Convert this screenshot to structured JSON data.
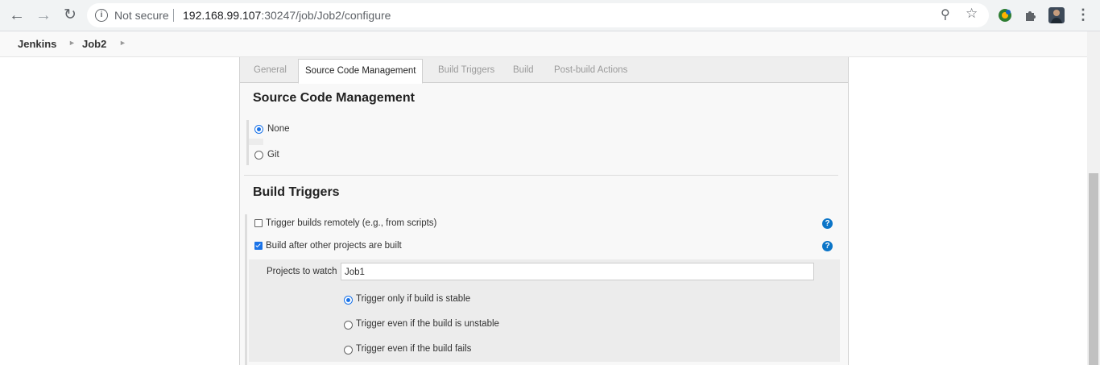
{
  "browser": {
    "not_secure": "Not secure",
    "url_host": "192.168.99.107",
    "url_rest": ":30247/job/Job2/configure",
    "icons": [
      "back-icon",
      "forward-icon",
      "reload-icon",
      "info-icon",
      "zoom-icon",
      "star-icon",
      "extension-icon",
      "puzzle-icon",
      "avatar",
      "menu-icon"
    ]
  },
  "breadcrumb": {
    "items": [
      "Jenkins",
      "Job2"
    ]
  },
  "tabs": [
    "General",
    "Source Code Management",
    "Build Triggers",
    "Build",
    "Post-build Actions"
  ],
  "scm": {
    "title": "Source Code Management",
    "options": [
      {
        "label": "None",
        "selected": true
      },
      {
        "label": "Git",
        "selected": false
      }
    ]
  },
  "triggers": {
    "title": "Build Triggers",
    "remote": {
      "label": "Trigger builds remotely (e.g., from scripts)",
      "checked": false
    },
    "after": {
      "label": "Build after other projects are built",
      "checked": true
    },
    "projects_label": "Projects to watch",
    "projects_value": "Job1",
    "conditions": [
      {
        "label": "Trigger only if build is stable",
        "selected": true
      },
      {
        "label": "Trigger even if the build is unstable",
        "selected": false
      },
      {
        "label": "Trigger even if the build fails",
        "selected": false
      }
    ]
  },
  "colors": {
    "accent": "#1a73e8",
    "help": "#0b75c8"
  }
}
